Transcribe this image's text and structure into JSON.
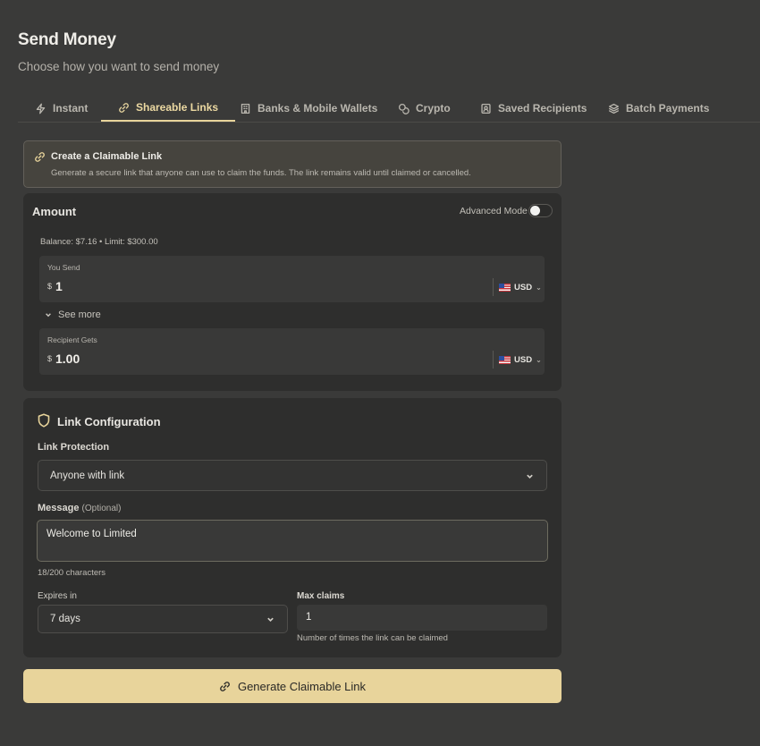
{
  "page": {
    "title": "Send Money",
    "subtitle": "Choose how you want to send money"
  },
  "tabs": [
    {
      "label": "Instant",
      "icon": "bolt-icon",
      "active": false
    },
    {
      "label": "Shareable Links",
      "icon": "link-icon",
      "active": true
    },
    {
      "label": "Banks & Mobile Wallets",
      "icon": "bank-icon",
      "active": false
    },
    {
      "label": "Crypto",
      "icon": "coins-icon",
      "active": false
    },
    {
      "label": "Saved Recipients",
      "icon": "contact-icon",
      "active": false
    },
    {
      "label": "Batch Payments",
      "icon": "layers-icon",
      "active": false
    }
  ],
  "banner": {
    "title": "Create a Claimable Link",
    "description": "Generate a secure link that anyone can use to claim the funds. The link remains valid until claimed or cancelled."
  },
  "amount": {
    "title": "Amount",
    "advanced_mode_label": "Advanced Mode",
    "advanced_mode_on": false,
    "balance_text": "Balance: $7.16 • Limit: $300.00",
    "you_send": {
      "label": "You Send",
      "symbol": "$",
      "value": "1",
      "currency": "USD"
    },
    "see_more": "See more",
    "recipient_gets": {
      "label": "Recipient Gets",
      "symbol": "$",
      "value": "1.00",
      "currency": "USD"
    }
  },
  "config": {
    "title": "Link Configuration",
    "protection_label": "Link Protection",
    "protection_value": "Anyone with link",
    "message_label": "Message",
    "message_optional": "(Optional)",
    "message_value": "Welcome to Limited",
    "message_counter": "18/200 characters",
    "expires_label": "Expires in",
    "expires_value": "7 days",
    "max_claims_label": "Max claims",
    "max_claims_value": "1",
    "max_claims_hint": "Number of times the link can be claimed"
  },
  "actions": {
    "generate_label": "Generate Claimable Link"
  },
  "colors": {
    "background": "#3a3a39",
    "card": "#2e2e2d",
    "accent": "#e8d49b"
  }
}
